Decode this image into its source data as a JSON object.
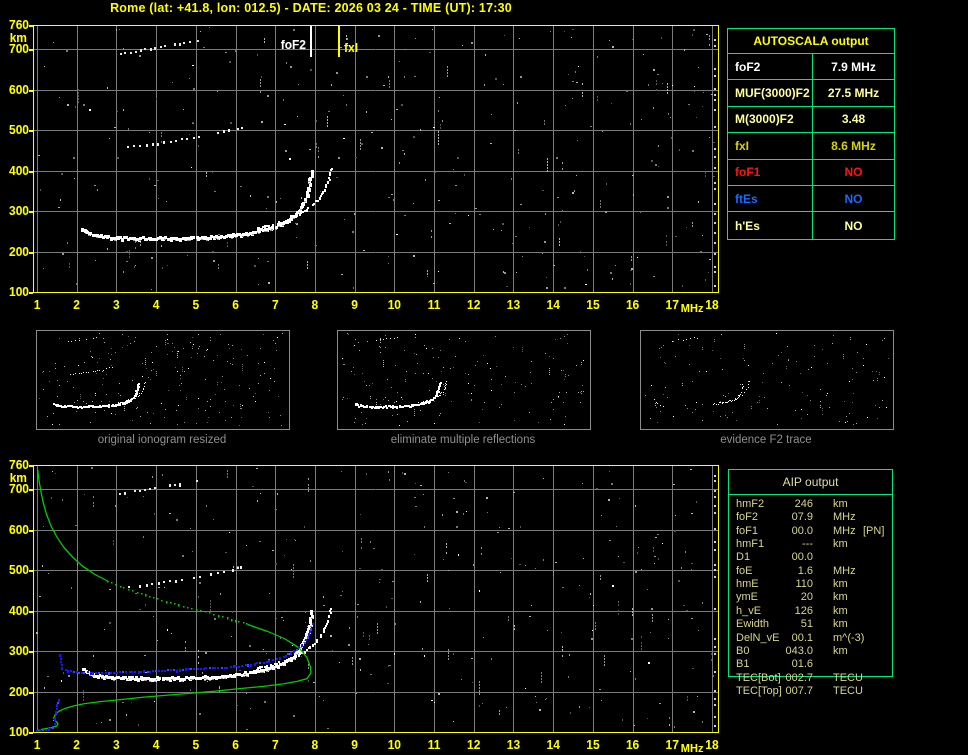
{
  "window": {
    "title": "Rome (lat: +41.8, lon: 012.5) - DATE: 2026 03 24 - TIME (UT): 17:30"
  },
  "colors": {
    "background": "#000000",
    "axis_yellow": "#ffff00",
    "grid_gray": "#7b7b7b",
    "table_border_green": "#00e87c",
    "trace_white": "#ffffff",
    "profile_green": "#00cc00",
    "fitted_blue": "#1616ff",
    "pale_yellow": "#ffff9c",
    "dark_yellow": "#d4d400",
    "red": "#ff1414",
    "blue_text": "#1a6aff",
    "aip_text": "#d6d68e",
    "thumb_gray": "#8f8f8f"
  },
  "autoscala": {
    "header": "AUTOSCALA output",
    "rows": [
      {
        "label": "foF2",
        "value": "7.9 MHz",
        "color": "#ffffff"
      },
      {
        "label": "MUF(3000)F2",
        "value": "27.5 MHz",
        "color": "#ffff9c"
      },
      {
        "label": "M(3000)F2",
        "value": "3.48",
        "color": "#ffff9c"
      },
      {
        "label": "fxI",
        "value": "8.6 MHz",
        "color": "#d4d400"
      },
      {
        "label": "foF1",
        "value": "NO",
        "color": "#ff1414"
      },
      {
        "label": "ftEs",
        "value": "NO",
        "color": "#1a6aff"
      },
      {
        "label": "h'Es",
        "value": "NO",
        "color": "#ffff9c"
      }
    ]
  },
  "aip": {
    "header": "AIP output",
    "rows": [
      {
        "label": "hmF2",
        "value": "246",
        "unit": "km",
        "extra": ""
      },
      {
        "label": "foF2",
        "value": "07.9",
        "unit": "MHz",
        "extra": ""
      },
      {
        "label": "foF1",
        "value": "00.0",
        "unit": "MHz",
        "extra": "[PN]"
      },
      {
        "label": "hmF1",
        "value": "---",
        "unit": "km",
        "extra": ""
      },
      {
        "label": "D1",
        "value": "00.0",
        "unit": "",
        "extra": ""
      },
      {
        "label": "foE",
        "value": "1.6",
        "unit": "MHz",
        "extra": ""
      },
      {
        "label": "hmE",
        "value": "110",
        "unit": "km",
        "extra": ""
      },
      {
        "label": "ymE",
        "value": "20",
        "unit": "km",
        "extra": ""
      },
      {
        "label": "h_vE",
        "value": "126",
        "unit": "km",
        "extra": ""
      },
      {
        "label": "Ewidth",
        "value": "51",
        "unit": "km",
        "extra": ""
      },
      {
        "label": "DelN_vE",
        "value": "00.1",
        "unit": "m^(-3)",
        "extra": ""
      },
      {
        "label": "B0",
        "value": "043.0",
        "unit": "km",
        "extra": ""
      },
      {
        "label": "B1",
        "value": "01.6",
        "unit": "",
        "extra": ""
      },
      {
        "label": "TEC[Bot]",
        "value": "002.7",
        "unit": "TECU",
        "extra": ""
      },
      {
        "label": "TEC[Top]",
        "value": "007.7",
        "unit": "TECU",
        "extra": ""
      }
    ]
  },
  "thumbnails": [
    {
      "label": "original ionogram resized"
    },
    {
      "label": "eliminate multiple reflections"
    },
    {
      "label": "evidence F2 trace"
    }
  ],
  "chart_data": {
    "traces": {
      "f2_ordinary": [
        [
          2.15,
          258
        ],
        [
          2.25,
          248
        ],
        [
          2.4,
          242
        ],
        [
          2.6,
          238
        ],
        [
          2.9,
          235
        ],
        [
          3.2,
          234
        ],
        [
          3.6,
          233
        ],
        [
          4.0,
          233
        ],
        [
          4.4,
          233
        ],
        [
          4.8,
          234
        ],
        [
          5.2,
          235
        ],
        [
          5.6,
          237
        ],
        [
          6.0,
          241
        ],
        [
          6.3,
          246
        ],
        [
          6.6,
          252
        ],
        [
          6.9,
          259
        ],
        [
          7.15,
          268
        ],
        [
          7.35,
          279
        ],
        [
          7.5,
          291
        ],
        [
          7.62,
          305
        ],
        [
          7.72,
          322
        ],
        [
          7.8,
          342
        ],
        [
          7.86,
          364
        ],
        [
          7.9,
          388
        ],
        [
          7.92,
          400
        ]
      ],
      "f2_extraordinary": [
        [
          6.55,
          258
        ],
        [
          6.8,
          263
        ],
        [
          7.05,
          269
        ],
        [
          7.3,
          277
        ],
        [
          7.55,
          288
        ],
        [
          7.75,
          300
        ],
        [
          7.95,
          314
        ],
        [
          8.1,
          330
        ],
        [
          8.22,
          348
        ],
        [
          8.32,
          368
        ],
        [
          8.38,
          388
        ],
        [
          8.42,
          405
        ]
      ],
      "second_hop": [
        [
          3.3,
          459
        ],
        [
          3.6,
          462
        ],
        [
          3.9,
          466
        ],
        [
          4.2,
          470
        ],
        [
          4.5,
          474
        ],
        [
          4.8,
          479
        ],
        [
          5.1,
          484
        ],
        [
          5.4,
          490
        ],
        [
          5.7,
          496
        ],
        [
          5.95,
          502
        ],
        [
          6.15,
          507
        ]
      ],
      "upper_trace": [
        [
          3.1,
          688
        ],
        [
          3.35,
          693
        ],
        [
          3.6,
          697
        ],
        [
          3.85,
          701
        ],
        [
          4.1,
          705
        ],
        [
          4.35,
          709
        ],
        [
          4.6,
          713
        ],
        [
          4.85,
          717
        ],
        [
          5.05,
          720
        ]
      ],
      "profile_topside_solid1": [
        [
          1.02,
          748
        ],
        [
          1.05,
          722
        ],
        [
          1.1,
          694
        ],
        [
          1.16,
          666
        ],
        [
          1.24,
          638
        ],
        [
          1.35,
          610
        ],
        [
          1.5,
          582
        ],
        [
          1.68,
          556
        ],
        [
          1.9,
          532
        ],
        [
          2.15,
          510
        ],
        [
          2.45,
          490
        ],
        [
          2.8,
          472
        ]
      ],
      "profile_topside_dotted": [
        [
          2.8,
          472
        ],
        [
          3.2,
          455
        ],
        [
          3.65,
          440
        ],
        [
          4.15,
          425
        ],
        [
          4.7,
          410
        ],
        [
          5.25,
          396
        ],
        [
          5.8,
          381
        ],
        [
          6.3,
          366
        ]
      ],
      "profile_topside_solid2": [
        [
          6.3,
          366
        ],
        [
          6.8,
          349
        ],
        [
          7.25,
          330
        ],
        [
          7.6,
          308
        ],
        [
          7.8,
          284
        ],
        [
          7.89,
          260
        ],
        [
          7.9,
          246
        ]
      ],
      "profile_bottomside": [
        [
          7.9,
          246
        ],
        [
          7.8,
          232
        ],
        [
          7.55,
          225
        ],
        [
          7.2,
          219
        ],
        [
          6.7,
          213
        ],
        [
          6.1,
          207
        ],
        [
          5.5,
          201
        ],
        [
          4.9,
          196
        ],
        [
          4.3,
          191
        ],
        [
          3.7,
          186
        ],
        [
          3.1,
          180
        ],
        [
          2.6,
          175
        ],
        [
          2.2,
          170
        ],
        [
          1.9,
          164
        ],
        [
          1.7,
          158
        ],
        [
          1.55,
          151
        ],
        [
          1.46,
          143
        ],
        [
          1.42,
          135
        ],
        [
          1.47,
          127
        ],
        [
          1.53,
          121
        ],
        [
          1.5,
          115
        ],
        [
          1.36,
          111
        ],
        [
          1.18,
          108
        ],
        [
          1.06,
          105
        ],
        [
          1.0,
          103
        ]
      ],
      "fitted_trace": [
        [
          1.58,
          290
        ],
        [
          1.6,
          272
        ],
        [
          1.64,
          258
        ],
        [
          1.72,
          252
        ],
        [
          1.85,
          249
        ],
        [
          2.0,
          247
        ],
        [
          2.2,
          246
        ],
        [
          2.5,
          246
        ],
        [
          2.8,
          246
        ],
        [
          3.1,
          247
        ],
        [
          3.4,
          248
        ],
        [
          3.7,
          249
        ],
        [
          4.0,
          250
        ],
        [
          4.3,
          252
        ],
        [
          4.6,
          253
        ],
        [
          4.9,
          255
        ],
        [
          5.2,
          256
        ],
        [
          5.5,
          258
        ],
        [
          5.8,
          260
        ],
        [
          6.1,
          263
        ],
        [
          6.4,
          267
        ],
        [
          6.7,
          272
        ],
        [
          6.95,
          278
        ],
        [
          7.2,
          286
        ],
        [
          7.4,
          294
        ],
        [
          7.55,
          304
        ],
        [
          7.68,
          315
        ],
        [
          7.78,
          328
        ],
        [
          7.85,
          342
        ],
        [
          7.9,
          356
        ],
        [
          7.93,
          366
        ]
      ],
      "fitted_low": [
        [
          1.0,
          103
        ],
        [
          1.07,
          104
        ],
        [
          1.14,
          105
        ],
        [
          1.22,
          106
        ],
        [
          1.3,
          108
        ],
        [
          1.38,
          111
        ],
        [
          1.44,
          120
        ],
        [
          1.5,
          158
        ],
        [
          1.55,
          180
        ]
      ],
      "f2_cusp_only": [
        [
          5.9,
          248
        ],
        [
          6.2,
          252
        ],
        [
          6.5,
          257
        ],
        [
          6.8,
          263
        ],
        [
          7.1,
          270
        ],
        [
          7.35,
          280
        ],
        [
          7.55,
          292
        ],
        [
          7.7,
          307
        ],
        [
          7.8,
          325
        ],
        [
          7.88,
          346
        ],
        [
          7.93,
          368
        ],
        [
          7.96,
          390
        ]
      ],
      "thumb3_dots": [
        [
          1.9,
          280
        ],
        [
          2.1,
          250
        ],
        [
          2.3,
          240
        ],
        [
          2.5,
          237
        ]
      ]
    },
    "charts": [
      {
        "id": "top-ionogram",
        "canvas": "topChart",
        "type": "scatter",
        "seed": 7,
        "noise": 300,
        "x_label": "MHz",
        "y_label": "km",
        "x_range": [
          1,
          18
        ],
        "y_range": [
          100,
          760
        ],
        "x_ticks": [
          1,
          2,
          3,
          4,
          5,
          6,
          7,
          8,
          9,
          10,
          11,
          12,
          13,
          14,
          15,
          16,
          17,
          18
        ],
        "y_ticks": [
          760,
          700,
          600,
          500,
          400,
          300,
          200,
          100
        ],
        "grid": true,
        "markers": [
          {
            "label": "foF2",
            "x": 7.9,
            "color": "#ffffff",
            "side": "left"
          },
          {
            "label": "fxI",
            "x": 8.6,
            "color": "#ffff00",
            "side": "right"
          }
        ],
        "series": [
          {
            "name": "F2 trace ordinary",
            "trace": "f2_ordinary",
            "style": "chunky"
          },
          {
            "name": "F2 trace extraordinary",
            "trace": "f2_extraordinary",
            "style": "medium"
          },
          {
            "name": "second hop echo",
            "trace": "second_hop",
            "style": "dotted"
          },
          {
            "name": "upper echo",
            "trace": "upper_trace",
            "style": "sparse"
          }
        ]
      },
      {
        "id": "bottom-ionogram",
        "canvas": "botChart",
        "type": "scatter",
        "seed": 13,
        "noise": 300,
        "x_label": "MHz",
        "y_label": "km",
        "x_range": [
          1,
          18
        ],
        "y_range": [
          100,
          760
        ],
        "x_ticks": [
          1,
          2,
          3,
          4,
          5,
          6,
          7,
          8,
          9,
          10,
          11,
          12,
          13,
          14,
          15,
          16,
          17,
          18
        ],
        "y_ticks": [
          760,
          700,
          600,
          500,
          400,
          300,
          200,
          100
        ],
        "grid": true,
        "markers": [],
        "series": [
          {
            "name": "F2 trace ordinary",
            "trace": "f2_ordinary",
            "style": "chunky"
          },
          {
            "name": "F2 trace extraordinary",
            "trace": "f2_extraordinary",
            "style": "medium"
          },
          {
            "name": "second hop echo",
            "trace": "second_hop",
            "style": "dotted"
          },
          {
            "name": "upper echo",
            "trace": "upper_trace",
            "style": "sparse"
          },
          {
            "name": "density profile topside",
            "trace": "profile_topside_solid1",
            "style": "green_solid"
          },
          {
            "name": "density profile topside dotted",
            "trace": "profile_topside_dotted",
            "style": "green_dotted"
          },
          {
            "name": "density profile near peak",
            "trace": "profile_topside_solid2",
            "style": "green_solid"
          },
          {
            "name": "density profile bottomside",
            "trace": "profile_bottomside",
            "style": "green_solid"
          },
          {
            "name": "restored F2 trace",
            "trace": "fitted_trace",
            "style": "blue"
          },
          {
            "name": "restored E trace",
            "trace": "fitted_low",
            "style": "blue"
          }
        ]
      },
      {
        "id": "thumb-original",
        "canvas": "thumbCanvas0",
        "type": "scatter",
        "seed": 21,
        "noise": 190,
        "series": [
          {
            "trace": "f2_ordinary",
            "style": "chunky"
          },
          {
            "trace": "f2_extraordinary",
            "style": "medium"
          },
          {
            "trace": "second_hop",
            "style": "dotted"
          },
          {
            "trace": "upper_trace",
            "style": "sparse"
          }
        ]
      },
      {
        "id": "thumb-no-multiples",
        "canvas": "thumbCanvas1",
        "type": "scatter",
        "seed": 33,
        "noise": 150,
        "series": [
          {
            "trace": "f2_ordinary",
            "style": "chunky"
          },
          {
            "trace": "f2_extraordinary",
            "style": "medium"
          },
          {
            "trace": "upper_trace",
            "style": "sparse"
          }
        ]
      },
      {
        "id": "thumb-f2-evidence",
        "canvas": "thumbCanvas2",
        "type": "scatter",
        "seed": 44,
        "noise": 120,
        "series": [
          {
            "trace": "f2_cusp_only",
            "style": "medium"
          },
          {
            "trace": "f2_extraordinary",
            "style": "dotted"
          },
          {
            "trace": "upper_trace",
            "style": "sparse"
          },
          {
            "trace": "thumb3_dots",
            "style": "dotted"
          }
        ]
      }
    ]
  }
}
